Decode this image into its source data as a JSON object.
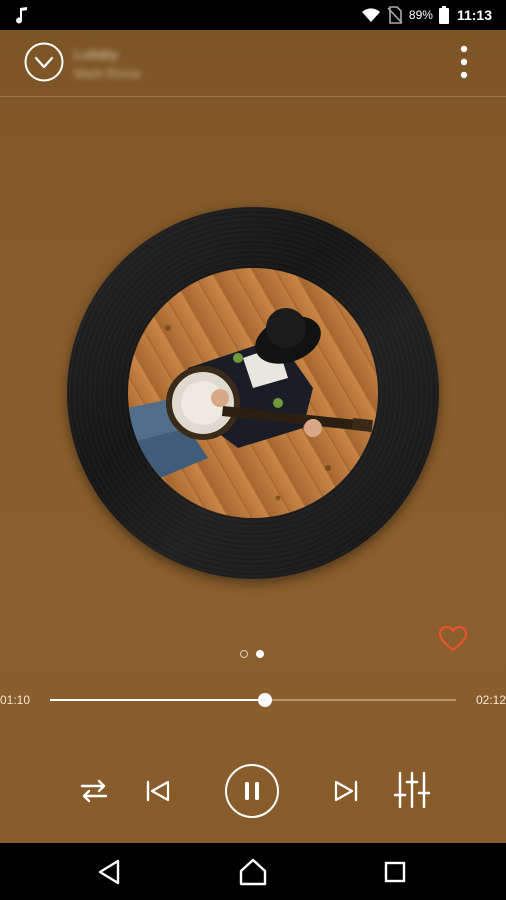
{
  "status_bar": {
    "battery_percent": "89%",
    "time": "11:13",
    "icons": [
      "music-note-icon",
      "wifi-icon",
      "no-sim-icon",
      "battery-icon"
    ]
  },
  "now_playing": {
    "title": "Lullaby",
    "artist": "Mark Rome",
    "favorite": true
  },
  "pager": {
    "count": 2,
    "active_index": 1
  },
  "progress": {
    "elapsed": "01:10",
    "total": "02:12",
    "fraction": 0.53
  },
  "controls": [
    "shuffle-icon",
    "previous-icon",
    "pause-icon",
    "next-icon",
    "equalizer-icon"
  ],
  "colors": {
    "background": "#8a5e2c",
    "accent_heart": "#e8532e",
    "status_bar": "#000000"
  },
  "nav_bar": [
    "back-icon",
    "home-icon",
    "recent-apps-icon"
  ]
}
